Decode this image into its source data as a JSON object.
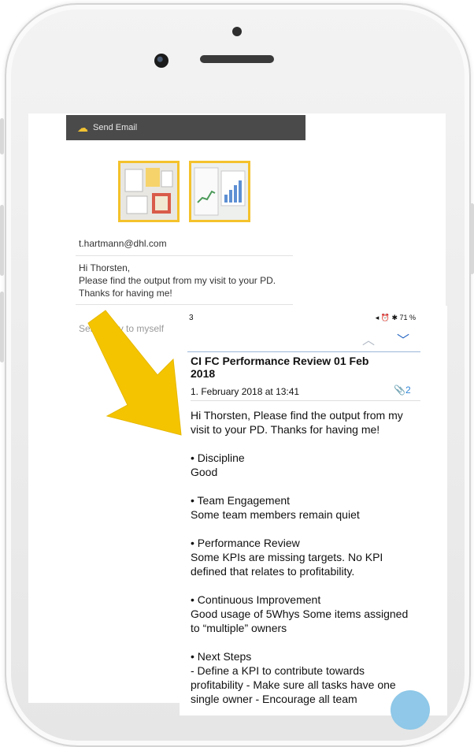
{
  "send_bar": {
    "label": "Send Email",
    "icon": "cloud-upload-icon"
  },
  "form": {
    "recipient": "t.hartmann@dhl.com",
    "body_lines": [
      "Hi Thorsten,",
      "Please find the output from my visit to your PD. Thanks for having me!"
    ],
    "send_copy_label": "Send copy to myself",
    "toggle_on": true
  },
  "mail": {
    "status_time": "3",
    "status_icons": "◂ ⏰ ✱ 71 %",
    "subject": "CI FC Performance Review 01 Feb 2018",
    "date": "1. February 2018 at 13:41",
    "attachments": "2",
    "intro": "Hi Thorsten, Please find the output from my visit to your PD. Thanks for having me!",
    "sections": [
      {
        "heading": "• Discipline",
        "text": "Good"
      },
      {
        "heading": "• Team Engagement",
        "text": "Some team members remain quiet"
      },
      {
        "heading": "• Performance Review",
        "text": "Some KPIs are missing targets. No KPI defined that relates to profitability."
      },
      {
        "heading": "• Continuous Improvement",
        "text": "Good usage of 5Whys Some items assigned to “multiple” owners"
      },
      {
        "heading": "• Next Steps",
        "text": "- Define a KPI to contribute towards profitability - Make sure all tasks have one single owner - Encourage all team"
      }
    ]
  },
  "colors": {
    "accent_yellow": "#f4c22b",
    "toggle_green": "#4cd964",
    "link_blue": "#2f86d8",
    "bar_dark": "#4a4a4a"
  }
}
